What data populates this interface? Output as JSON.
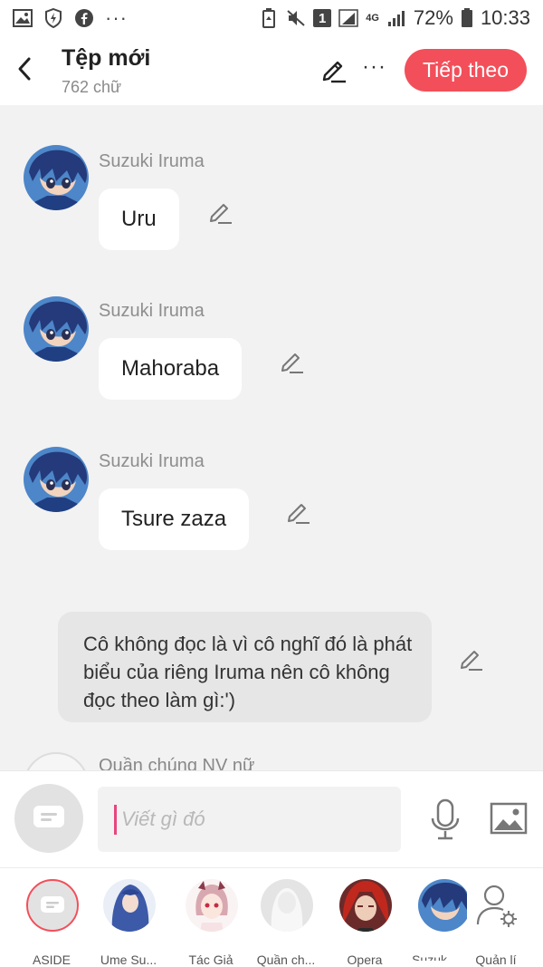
{
  "status_bar": {
    "battery_percent": "72%",
    "time": "10:33",
    "sim_slot": "1",
    "network": "4G",
    "more": "···"
  },
  "header": {
    "title": "Tệp mới",
    "subtitle": "762 chữ",
    "more": "···",
    "next_label": "Tiếp theo"
  },
  "messages": [
    {
      "sender": "Suzuki Iruma",
      "text": "Uru"
    },
    {
      "sender": "Suzuki Iruma",
      "text": "Mahoraba"
    },
    {
      "sender": "Suzuki Iruma",
      "text": "Tsure zaza"
    }
  ],
  "narration": {
    "text": "Cô không đọc là vì cô nghĩ đó là phát biểu của riêng Iruma nên cô không đọc theo làm gì:')"
  },
  "partial_message": {
    "sender": "Quần chúng NV nữ"
  },
  "composer": {
    "placeholder": "Viết gì đó"
  },
  "characters": [
    {
      "label": "ASIDE"
    },
    {
      "label": "Ume Su..."
    },
    {
      "label": "Tác Giả"
    },
    {
      "label": "Quần ch..."
    },
    {
      "label": "Opera"
    },
    {
      "label": "Suzuk"
    },
    {
      "label": "Quản lí"
    }
  ],
  "colors": {
    "accent": "#f24f5a",
    "caret": "#e8457d",
    "background": "#f2f2f2",
    "bubble": "#ffffff",
    "narration_bubble": "#e6e6e6"
  }
}
